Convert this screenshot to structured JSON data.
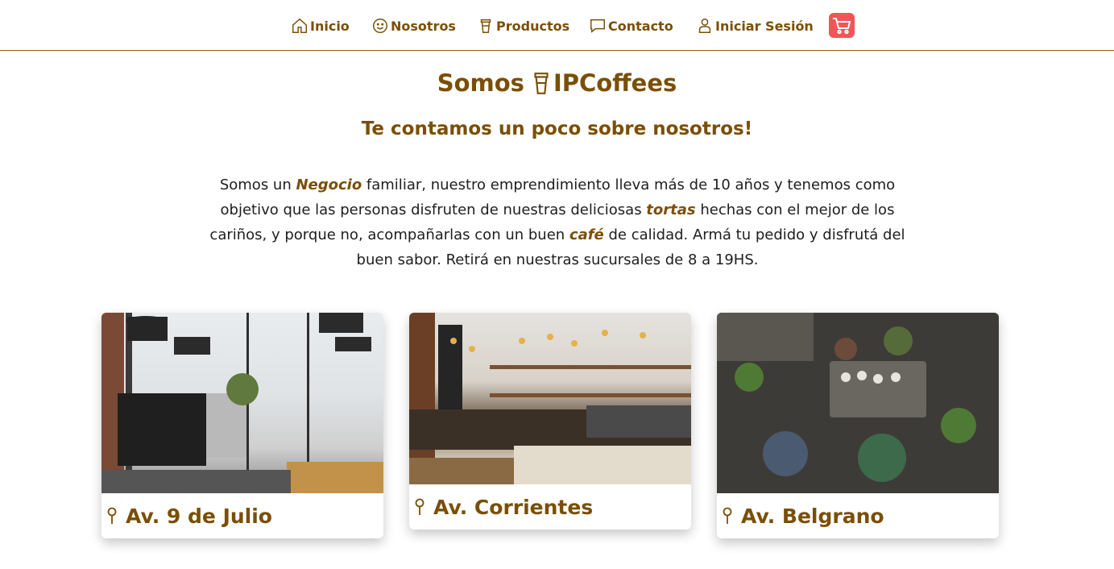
{
  "nav": {
    "items": [
      {
        "label": "Inicio",
        "icon": "home-icon"
      },
      {
        "label": "Nosotros",
        "icon": "smile-icon"
      },
      {
        "label": "Productos",
        "icon": "coffee-cup-icon"
      },
      {
        "label": "Contacto",
        "icon": "chat-icon"
      },
      {
        "label": "Iniciar Sesión",
        "icon": "user-icon"
      }
    ],
    "cart_icon": "cart-icon",
    "cart_color": "#f25557"
  },
  "hero": {
    "title_prefix": "Somos",
    "title_brand": "IPCoffees",
    "subtitle": "Te contamos un poco sobre nosotros!"
  },
  "intro": {
    "part1": "Somos un ",
    "em1": "Negocio",
    "part2": " familiar, nuestro emprendimiento lleva más de 10 años y tenemos como objetivo que las personas disfruten de nuestras deliciosas ",
    "em2": "tortas",
    "part3": " hechas con el mejor de los cariños, y porque no, acompañarlas con un buen ",
    "em3": "café",
    "part4": " de calidad. Armá tu pedido y disfrutá del buen sabor. Retirá en nuestras sucursales de 8 a 19HS."
  },
  "branches": [
    {
      "name": "Av. 9 de Julio",
      "icon": "location-pin-icon"
    },
    {
      "name": "Av. Corrientes",
      "icon": "location-pin-icon"
    },
    {
      "name": "Av. Belgrano",
      "icon": "location-pin-icon"
    }
  ],
  "colors": {
    "brand": "#7a4f05",
    "nav_border": "#8b5e0f"
  }
}
